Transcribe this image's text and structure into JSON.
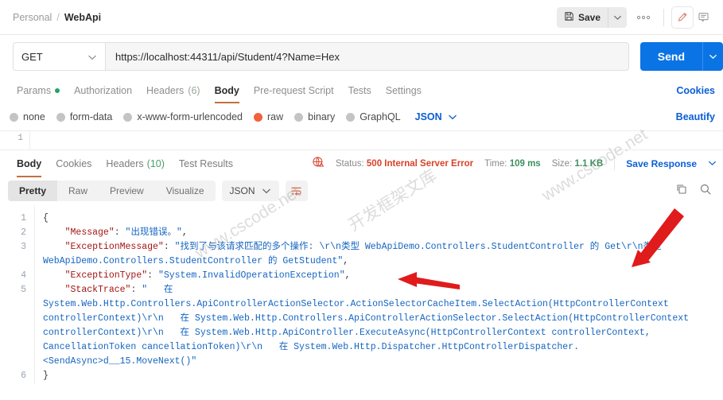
{
  "breadcrumb": {
    "workspace": "Personal",
    "separator": "/",
    "request": "WebApi"
  },
  "topbar": {
    "save_label": "Save",
    "save_caret": "∨",
    "more_label": "●●●",
    "edit_icon": "pencil-icon",
    "comment_icon": "comment-icon"
  },
  "request": {
    "method": "GET",
    "method_caret": "∨",
    "url": "https://localhost:44311/api/Student/4?Name=Hex",
    "send_label": "Send",
    "send_caret": "∨"
  },
  "request_tabs": {
    "items": [
      {
        "label": "Params",
        "badge": "dot",
        "active": false
      },
      {
        "label": "Authorization",
        "badge": "",
        "active": false
      },
      {
        "label": "Headers",
        "count": "(6)",
        "active": false
      },
      {
        "label": "Body",
        "badge": "",
        "active": true
      },
      {
        "label": "Pre-request Script",
        "badge": "",
        "active": false
      },
      {
        "label": "Tests",
        "badge": "",
        "active": false
      },
      {
        "label": "Settings",
        "badge": "",
        "active": false
      }
    ],
    "cookies_link": "Cookies"
  },
  "body_types": {
    "options": [
      {
        "label": "none",
        "selected": false
      },
      {
        "label": "form-data",
        "selected": false
      },
      {
        "label": "x-www-form-urlencoded",
        "selected": false
      },
      {
        "label": "raw",
        "selected": true
      },
      {
        "label": "binary",
        "selected": false
      },
      {
        "label": "GraphQL",
        "selected": false
      }
    ],
    "format": "JSON",
    "format_caret": "∨",
    "beautify_label": "Beautify"
  },
  "request_editor": {
    "line_number": "1"
  },
  "response_tabs": {
    "items": [
      {
        "label": "Body",
        "active": true
      },
      {
        "label": "Cookies",
        "active": false
      },
      {
        "label": "Headers",
        "count": "(10)",
        "active": false
      },
      {
        "label": "Test Results",
        "active": false
      }
    ],
    "status_icon": "globe-warning-icon",
    "status_label": "Status:",
    "status_value": "500 Internal Server Error",
    "time_label": "Time:",
    "time_value": "109 ms",
    "size_label": "Size:",
    "size_value": "1.1 KB",
    "save_response": "Save Response",
    "save_response_caret": "∨"
  },
  "viewer": {
    "modes": [
      {
        "label": "Pretty",
        "active": true
      },
      {
        "label": "Raw",
        "active": false
      },
      {
        "label": "Preview",
        "active": false
      },
      {
        "label": "Visualize",
        "active": false
      }
    ],
    "format": "JSON",
    "format_caret": "∨",
    "wrap_icon": "word-wrap-icon",
    "copy_icon": "copy-icon",
    "search_icon": "search-icon"
  },
  "response_body": {
    "line_numbers": [
      "1",
      "2",
      "3",
      "4",
      "5",
      "6"
    ],
    "lines": [
      {
        "n": "1",
        "segments": [
          {
            "t": "brace",
            "v": "{"
          }
        ]
      },
      {
        "n": "2",
        "segments": [
          {
            "t": "pad",
            "v": "    "
          },
          {
            "t": "key",
            "v": "\"Message\""
          },
          {
            "t": "punct",
            "v": ": "
          },
          {
            "t": "str",
            "v": "\"出现错误。\""
          },
          {
            "t": "punct",
            "v": ","
          }
        ]
      },
      {
        "n": "3",
        "segments": [
          {
            "t": "pad",
            "v": "    "
          },
          {
            "t": "key",
            "v": "\"ExceptionMessage\""
          },
          {
            "t": "punct",
            "v": ": "
          },
          {
            "t": "str",
            "v": "\"找到了与该请求匹配的多个操作: \\r\\n类型 WebApiDemo.Controllers.StudentController 的 Get\\r\\n类型 WebApiDemo.Controllers.StudentController 的 GetStudent\""
          },
          {
            "t": "punct",
            "v": ","
          }
        ]
      },
      {
        "n": "4",
        "segments": [
          {
            "t": "pad",
            "v": "    "
          },
          {
            "t": "key",
            "v": "\"ExceptionType\""
          },
          {
            "t": "punct",
            "v": ": "
          },
          {
            "t": "str",
            "v": "\"System.InvalidOperationException\""
          },
          {
            "t": "punct",
            "v": ","
          }
        ]
      },
      {
        "n": "5",
        "segments": [
          {
            "t": "pad",
            "v": "    "
          },
          {
            "t": "key",
            "v": "\"StackTrace\""
          },
          {
            "t": "punct",
            "v": ": "
          },
          {
            "t": "str",
            "v": "\"   在 System.Web.Http.Controllers.ApiControllerActionSelector.ActionSelectorCacheItem.SelectAction(HttpControllerContext controllerContext)\\r\\n   在 System.Web.Http.Controllers.ApiControllerActionSelector.SelectAction(HttpControllerContext controllerContext)\\r\\n   在 System.Web.Http.ApiController.ExecuteAsync(HttpControllerContext controllerContext, CancellationToken cancellationToken)\\r\\n   在 System.Web.Http.Dispatcher.HttpControllerDispatcher.<SendAsync>d__15.MoveNext()\""
          }
        ]
      },
      {
        "n": "6",
        "segments": [
          {
            "t": "brace",
            "v": "}"
          }
        ]
      }
    ]
  },
  "annotations": {
    "arrow_color": "#e01b1b",
    "arrow_1": "points-down-left-to-Get",
    "arrow_2": "points-left-to-GetStudent"
  },
  "watermark": {
    "line1": "www.cscode.net",
    "line2": "开发框架文库"
  },
  "colors": {
    "accent_blue": "#0b74e5",
    "link_blue": "#0b5ed7",
    "tab_underline": "#c2703f",
    "error_red": "#d9412a",
    "success_green": "#21a366",
    "raw_orange": "#f2603c"
  }
}
